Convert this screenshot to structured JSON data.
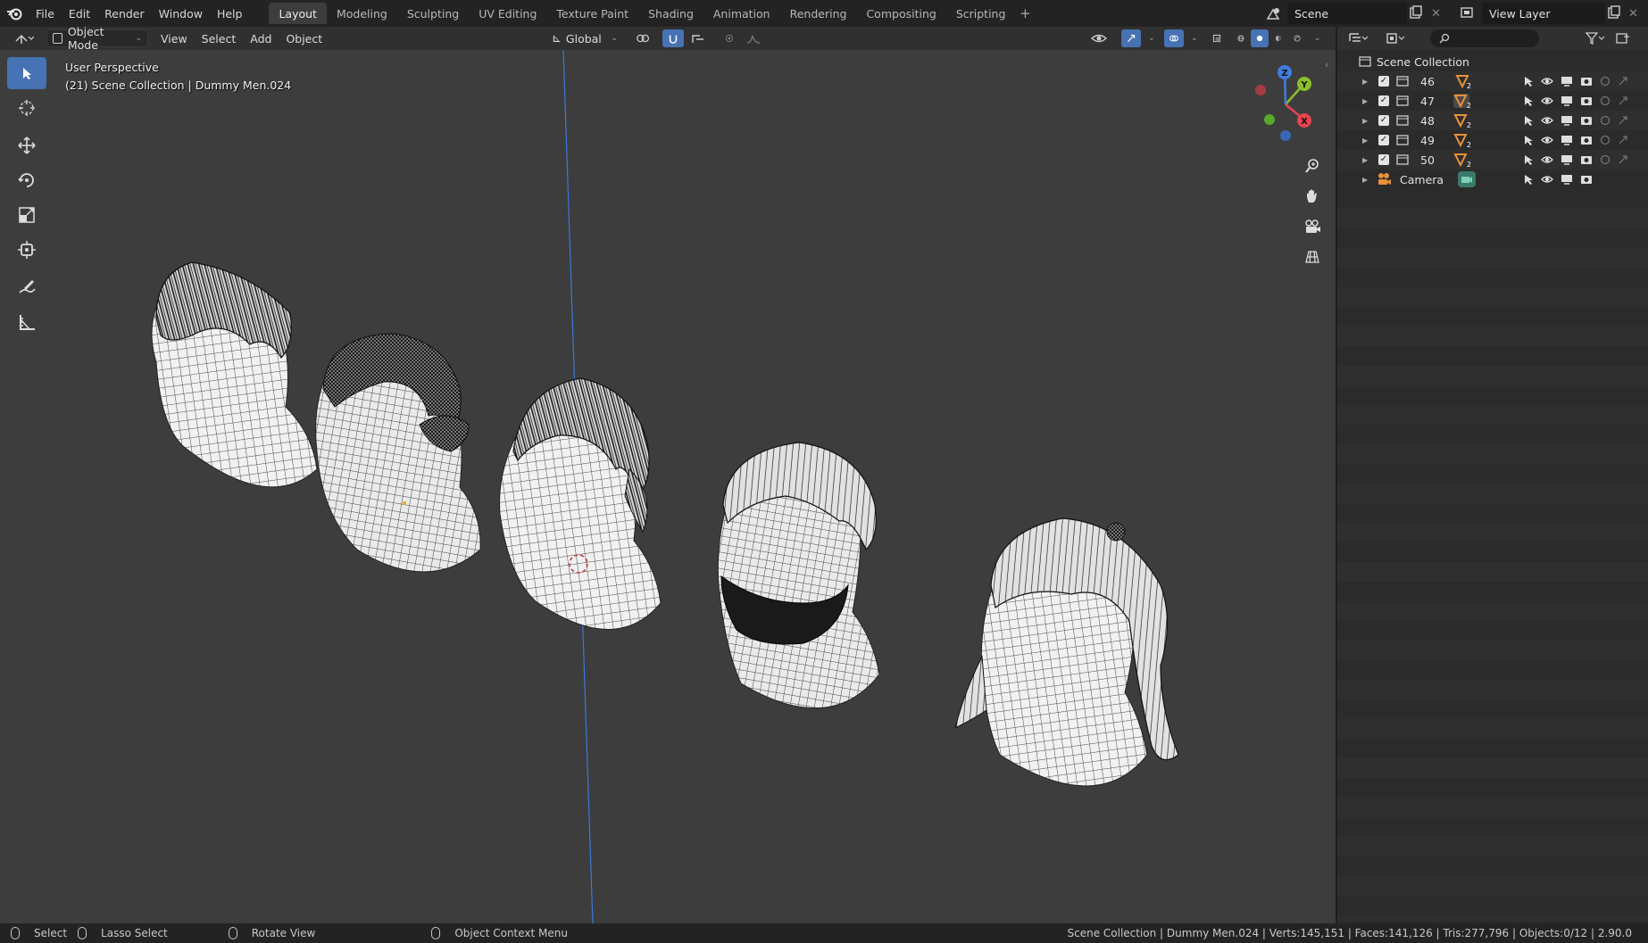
{
  "menu": {
    "items": [
      "File",
      "Edit",
      "Render",
      "Window",
      "Help"
    ]
  },
  "workspaces": {
    "tabs": [
      "Layout",
      "Modeling",
      "Sculpting",
      "UV Editing",
      "Texture Paint",
      "Shading",
      "Animation",
      "Rendering",
      "Compositing",
      "Scripting"
    ],
    "active": "Layout",
    "add_label": "+"
  },
  "scene": {
    "name": "Scene"
  },
  "view_layer": {
    "name": "View Layer"
  },
  "header": {
    "mode": "Object Mode",
    "menus": [
      "View",
      "Select",
      "Add",
      "Object"
    ],
    "orientation": "Global"
  },
  "viewport": {
    "perspective_label": "User Perspective",
    "collection_label": "(21) Scene Collection | Dummy Men.024",
    "background": "#3d3d3d",
    "axis_colors": {
      "x": "#e8434f",
      "y": "#8bbf2b",
      "z": "#3e7ee0"
    }
  },
  "gizmo": {
    "x": "X",
    "y": "Y",
    "z": "Z"
  },
  "outliner": {
    "root": "Scene Collection",
    "rows": [
      {
        "name": "46",
        "badge": "2"
      },
      {
        "name": "47",
        "badge": "2"
      },
      {
        "name": "48",
        "badge": "2"
      },
      {
        "name": "49",
        "badge": "2"
      },
      {
        "name": "50",
        "badge": "2"
      }
    ],
    "camera": {
      "name": "Camera"
    }
  },
  "statusbar": {
    "select": "Select",
    "lasso": "Lasso Select",
    "rotate": "Rotate View",
    "context": "Object Context Menu",
    "stats": "Scene Collection | Dummy Men.024 | Verts:145,151 | Faces:141,126 | Tris:277,796 | Objects:0/12 | 2.90.0"
  },
  "icons": {
    "toolbar": [
      "select-box-icon",
      "cursor-icon",
      "move-icon",
      "rotate-icon",
      "scale-icon",
      "transform-icon",
      "annotate-icon",
      "measure-icon"
    ],
    "nav": [
      "zoom-icon",
      "pan-hand-icon",
      "camera-view-icon",
      "ortho-grid-icon"
    ]
  }
}
